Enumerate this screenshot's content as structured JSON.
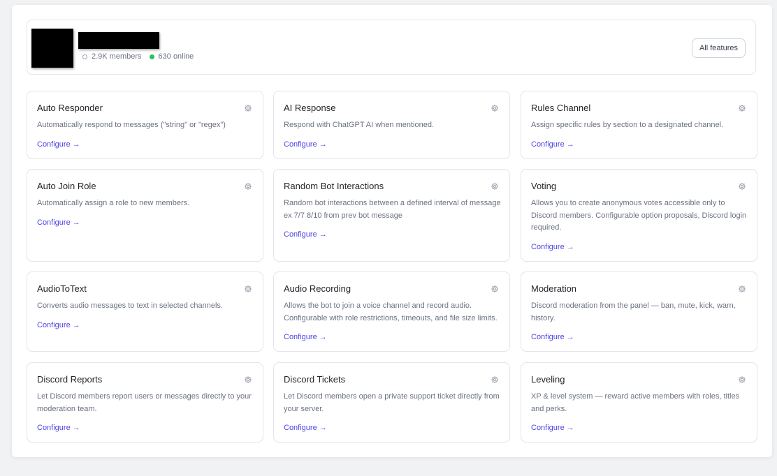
{
  "server": {
    "members": "2.9K members",
    "online": "630 online",
    "all_features_label": "All features"
  },
  "colors": {
    "accent": "#4f46e5",
    "online": "#22c55e",
    "text_muted": "#6b7280",
    "border": "#e3e5e8"
  },
  "features": [
    {
      "title": "Auto Responder",
      "description": "Automatically respond to messages (\"string\" or \"regex\")",
      "action": "Configure →"
    },
    {
      "title": "AI Response",
      "description": "Respond with ChatGPT AI when mentioned.",
      "action": "Configure →"
    },
    {
      "title": "Rules Channel",
      "description": "Assign specific rules by section to a designated channel.",
      "action": "Configure →"
    },
    {
      "title": "Auto Join Role",
      "description": "Automatically assign a role to new members.",
      "action": "Configure →"
    },
    {
      "title": "Random Bot Interactions",
      "description": "Random bot interactions between a defined interval of message ex 7/7 8/10 from prev bot message",
      "action": "Configure →"
    },
    {
      "title": "Voting",
      "description": "Allows you to create anonymous votes accessible only to Discord members. Configurable option proposals, Discord login required.",
      "action": "Configure →"
    },
    {
      "title": "AudioToText",
      "description": "Converts audio messages to text in selected channels.",
      "action": "Configure →"
    },
    {
      "title": "Audio Recording",
      "description": "Allows the bot to join a voice channel and record audio. Configurable with role restrictions, timeouts, and file size limits.",
      "action": "Configure →"
    },
    {
      "title": "Moderation",
      "description": "Discord moderation from the panel — ban, mute, kick, warn, history.",
      "action": "Configure →"
    },
    {
      "title": "Discord Reports",
      "description": "Let Discord members report users or messages directly to your moderation team.",
      "action": "Configure →"
    },
    {
      "title": "Discord Tickets",
      "description": "Let Discord members open a private support ticket directly from your server.",
      "action": "Configure →"
    },
    {
      "title": "Leveling",
      "description": "XP & level system — reward active members with roles, titles and perks.",
      "action": "Configure →"
    }
  ]
}
